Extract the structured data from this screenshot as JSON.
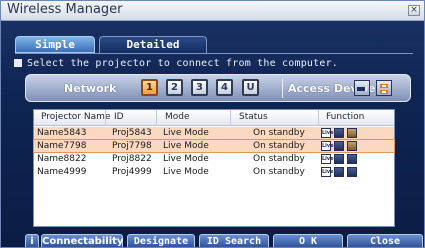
{
  "window": {
    "title": "Wireless Manager",
    "close_glyph": "×"
  },
  "tabs": [
    {
      "label": "Simple",
      "active": false
    },
    {
      "label": "Detailed",
      "active": true
    }
  ],
  "instruction": "Select the projector to connect from the computer.",
  "network": {
    "label": "Network",
    "buttons": [
      "1",
      "2",
      "3",
      "4",
      "U"
    ],
    "active_index": 0,
    "access_label": "Access Device",
    "access_icons": [
      "device-list-icon",
      "device-settings-icon"
    ]
  },
  "table": {
    "columns": [
      "Projector Name",
      "ID",
      "Mode",
      "Status",
      "Function"
    ],
    "rows": [
      {
        "name": "Name5843",
        "id": "Proj5843",
        "mode": "Live Mode",
        "status": "On standby",
        "highlight": "hover"
      },
      {
        "name": "Name7798",
        "id": "Proj7798",
        "mode": "Live Mode",
        "status": "On standby",
        "highlight": "selected"
      },
      {
        "name": "Name8822",
        "id": "Proj8822",
        "mode": "Live Mode",
        "status": "On standby",
        "highlight": "none"
      },
      {
        "name": "Name4999",
        "id": "Proj4999",
        "mode": "Live Mode",
        "status": "On standby",
        "highlight": "none"
      }
    ],
    "function_icons": [
      "live-icon",
      "monitor-icon",
      "settings-icon"
    ],
    "live_icon_text": "Live"
  },
  "bottom": {
    "info_label": "i",
    "connectability_label": "Connectability",
    "designate_label": "Designate",
    "id_search_label": "ID Search",
    "ok_label": "O K",
    "close_label": "Close"
  },
  "colors": {
    "accent": "#2b4f96",
    "row_highlight": "#fbd9c0",
    "active_network": "#f0a040"
  }
}
